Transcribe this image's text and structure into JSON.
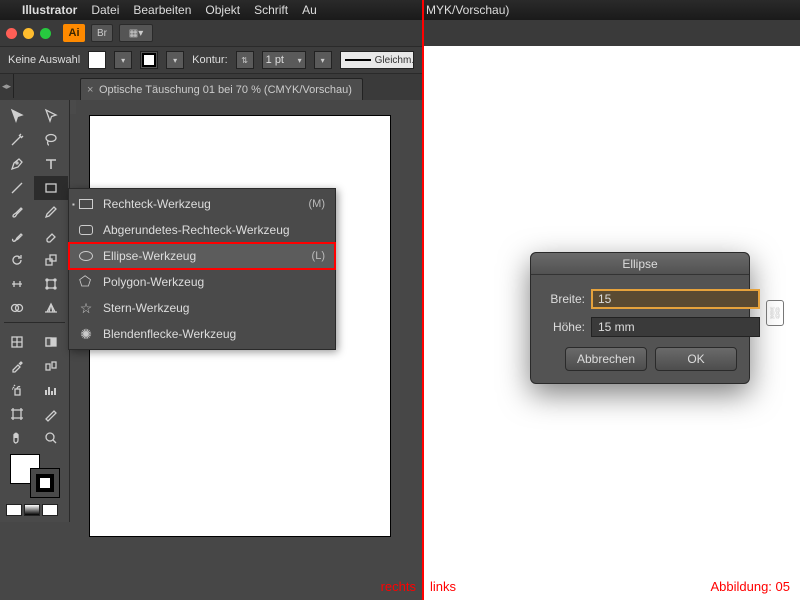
{
  "menubar": {
    "app": "Illustrator",
    "items": [
      "Datei",
      "Bearbeiten",
      "Objekt",
      "Schrift",
      "Au"
    ]
  },
  "right_menubar_fragment": "MYK/Vorschau)",
  "control_bar": {
    "selection": "Keine Auswahl",
    "label_kontur": "Kontur:",
    "stroke_width": "1 pt",
    "line_style": "Gleichm."
  },
  "document_tab": "Optische Täuschung 01 bei 70 % (CMYK/Vorschau)",
  "flyout": {
    "items": [
      {
        "label": "Rechteck-Werkzeug",
        "shortcut": "(M)",
        "current": true
      },
      {
        "label": "Abgerundetes-Rechteck-Werkzeug",
        "shortcut": ""
      },
      {
        "label": "Ellipse-Werkzeug",
        "shortcut": "(L)",
        "highlight": true
      },
      {
        "label": "Polygon-Werkzeug",
        "shortcut": ""
      },
      {
        "label": "Stern-Werkzeug",
        "shortcut": ""
      },
      {
        "label": "Blendenflecke-Werkzeug",
        "shortcut": ""
      }
    ]
  },
  "dialog": {
    "title": "Ellipse",
    "width_label": "Breite:",
    "width_value": "15",
    "height_label": "Höhe:",
    "height_value": "15 mm",
    "cancel": "Abbrechen",
    "ok": "OK"
  },
  "labels": {
    "rechts": "rechts",
    "links": "links",
    "abbildung": "Abbildung: 05"
  },
  "colors": {
    "accent_highlight": "#ff0000",
    "dialog_active_border": "#e6a23c"
  }
}
